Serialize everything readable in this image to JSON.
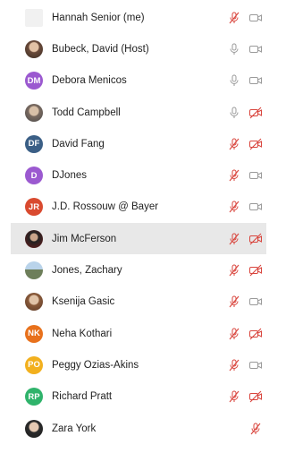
{
  "participants": [
    {
      "name": "Hannah Senior (me)",
      "avatar_type": "blank",
      "avatar_text": "",
      "avatar_color": "#f1f1f1",
      "mic": "muted",
      "video": "on"
    },
    {
      "name": "Bubeck, David (Host)",
      "avatar_type": "photo",
      "avatar_text": "",
      "avatar_color": "#6b4b3a",
      "mic": "on",
      "video": "on"
    },
    {
      "name": "Debora Menicos",
      "avatar_type": "initials",
      "avatar_text": "DM",
      "avatar_color": "#9b59d0",
      "mic": "on",
      "video": "on"
    },
    {
      "name": "Todd Campbell",
      "avatar_type": "photo2",
      "avatar_text": "",
      "avatar_color": "#7a6a60",
      "mic": "on",
      "video": "off"
    },
    {
      "name": "David Fang",
      "avatar_type": "initials",
      "avatar_text": "DF",
      "avatar_color": "#3b5f86",
      "mic": "muted",
      "video": "off"
    },
    {
      "name": "DJones",
      "avatar_type": "initials",
      "avatar_text": "D",
      "avatar_color": "#9b59d0",
      "mic": "muted",
      "video": "on"
    },
    {
      "name": "J.D. Rossouw @ Bayer",
      "avatar_type": "initials",
      "avatar_text": "JR",
      "avatar_color": "#d94a2f",
      "mic": "muted",
      "video": "on"
    },
    {
      "name": "Jim McFerson",
      "avatar_type": "photo3",
      "avatar_text": "",
      "avatar_color": "#6b1d1d",
      "mic": "muted",
      "video": "off",
      "highlighted": true
    },
    {
      "name": "Jones, Zachary",
      "avatar_type": "photo4",
      "avatar_text": "",
      "avatar_color": "#6d7e5a",
      "mic": "muted",
      "video": "off"
    },
    {
      "name": "Ksenija Gasic",
      "avatar_type": "photo5",
      "avatar_text": "",
      "avatar_color": "#8a5a3a",
      "mic": "muted",
      "video": "on"
    },
    {
      "name": "Neha Kothari",
      "avatar_type": "initials",
      "avatar_text": "NK",
      "avatar_color": "#e8711c",
      "mic": "muted",
      "video": "off"
    },
    {
      "name": "Peggy Ozias-Akins",
      "avatar_type": "initials",
      "avatar_text": "PO",
      "avatar_color": "#f2b01e",
      "mic": "muted",
      "video": "on"
    },
    {
      "name": "Richard Pratt",
      "avatar_type": "initials",
      "avatar_text": "RP",
      "avatar_color": "#2fb36b",
      "mic": "muted",
      "video": "off"
    },
    {
      "name": "Zara York",
      "avatar_type": "photo6",
      "avatar_text": "",
      "avatar_color": "#1d1d1d",
      "mic": "muted",
      "video": "none"
    }
  ],
  "colors": {
    "muted_red": "#d9453d",
    "icon_gray": "#9a9a9a"
  },
  "icons": {
    "mic_on": "microphone-icon",
    "mic_muted": "microphone-muted-icon",
    "video_on": "video-camera-icon",
    "video_off": "video-camera-off-icon"
  }
}
